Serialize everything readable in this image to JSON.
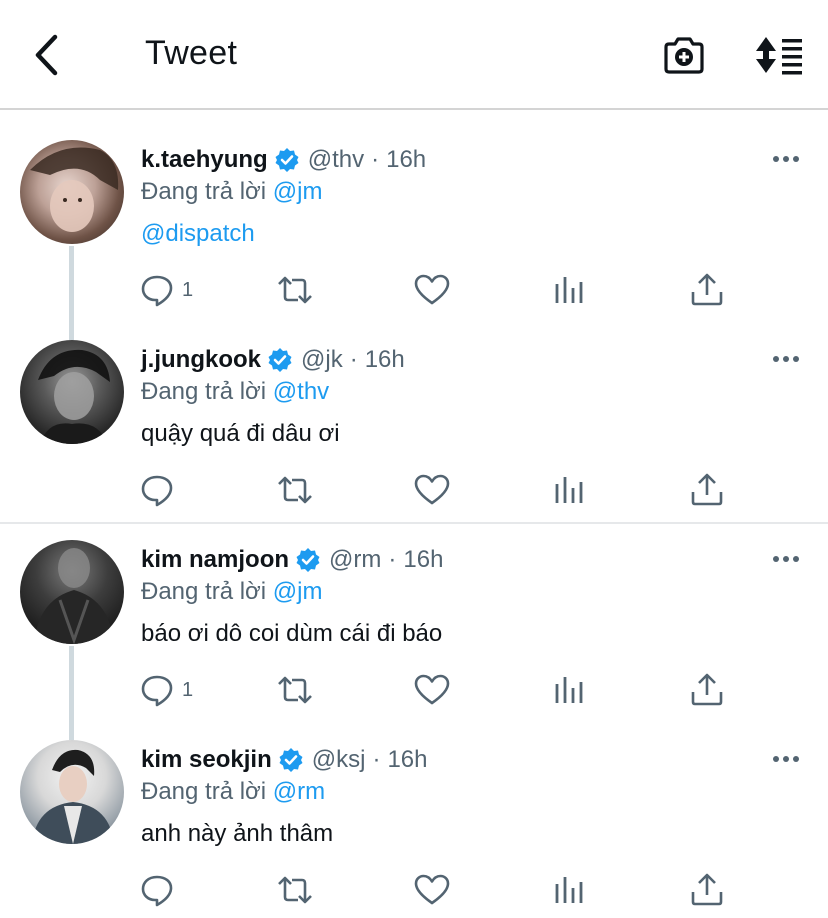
{
  "header": {
    "title": "Tweet",
    "back_icon": "chevron-left-icon",
    "camera_icon": "camera-plus-icon",
    "sort_icon": "sort-icon"
  },
  "colors": {
    "accent": "#1d9bf0",
    "text": "#0f1419",
    "secondary": "#536471",
    "divider": "#e6e8ea",
    "thread_line": "#cfd9de"
  },
  "tweets": [
    {
      "name": "k.taehyung",
      "handle": "@thv",
      "separator": "·",
      "time": "16h",
      "replying_prefix": "Đang trả lời",
      "replying_to": "@jm",
      "text": "@dispatch",
      "reply_count": "1"
    },
    {
      "name": "j.jungkook",
      "handle": "@jk",
      "separator": "·",
      "time": "16h",
      "replying_prefix": "Đang trả lời",
      "replying_to": "@thv",
      "text": "quậy quá đi dâu ơi",
      "reply_count": ""
    },
    {
      "name": "kim namjoon",
      "handle": "@rm",
      "separator": "·",
      "time": "16h",
      "replying_prefix": "Đang trả lời",
      "replying_to": "@jm",
      "text": "báo ơi dô coi dùm cái đi báo",
      "reply_count": "1"
    },
    {
      "name": "kim seokjin",
      "handle": "@ksj",
      "separator": "·",
      "time": "16h",
      "replying_prefix": "Đang trả lời",
      "replying_to": "@rm",
      "text": "anh này ảnh thâm",
      "reply_count": ""
    }
  ]
}
